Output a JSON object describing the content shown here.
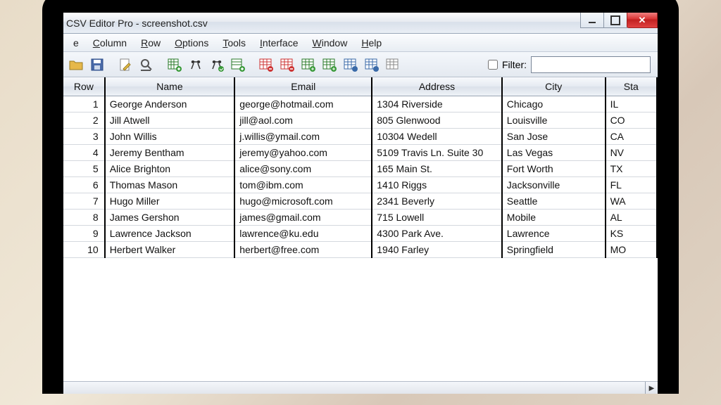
{
  "window": {
    "title": "CSV Editor Pro - screenshot.csv"
  },
  "menu": {
    "file_tail": "e",
    "column": "Column",
    "row": "Row",
    "options": "Options",
    "tools": "Tools",
    "interface": "Interface",
    "window": "Window",
    "help": "Help"
  },
  "toolbar": {
    "filter_label": "Filter:",
    "filter_value": ""
  },
  "columns": {
    "row": "Row",
    "name": "Name",
    "email": "Email",
    "address": "Address",
    "city": "City",
    "state": "Sta"
  },
  "rows": [
    {
      "n": "1",
      "name": "George Anderson",
      "email": "george@hotmail.com",
      "address": "1304 Riverside",
      "city": "Chicago",
      "state": "IL"
    },
    {
      "n": "2",
      "name": "Jill Atwell",
      "email": "jill@aol.com",
      "address": "805 Glenwood",
      "city": "Louisville",
      "state": "CO"
    },
    {
      "n": "3",
      "name": "John Willis",
      "email": "j.willis@ymail.com",
      "address": "10304 Wedell",
      "city": "San Jose",
      "state": "CA"
    },
    {
      "n": "4",
      "name": "Jeremy Bentham",
      "email": "jeremy@yahoo.com",
      "address": "5109 Travis Ln. Suite 30",
      "city": "Las Vegas",
      "state": "NV"
    },
    {
      "n": "5",
      "name": "Alice Brighton",
      "email": "alice@sony.com",
      "address": "165 Main St.",
      "city": "Fort Worth",
      "state": "TX"
    },
    {
      "n": "6",
      "name": "Thomas Mason",
      "email": "tom@ibm.com",
      "address": "1410 Riggs",
      "city": "Jacksonville",
      "state": "FL"
    },
    {
      "n": "7",
      "name": "Hugo Miller",
      "email": "hugo@microsoft.com",
      "address": "2341 Beverly",
      "city": "Seattle",
      "state": "WA"
    },
    {
      "n": "8",
      "name": "James Gershon",
      "email": "james@gmail.com",
      "address": "715 Lowell",
      "city": "Mobile",
      "state": "AL"
    },
    {
      "n": "9",
      "name": "Lawrence Jackson",
      "email": "lawrence@ku.edu",
      "address": "4300 Park Ave.",
      "city": "Lawrence",
      "state": "KS"
    },
    {
      "n": "10",
      "name": "Herbert Walker",
      "email": "herbert@free.com",
      "address": "1940 Farley",
      "city": "Springfield",
      "state": "MO"
    }
  ]
}
